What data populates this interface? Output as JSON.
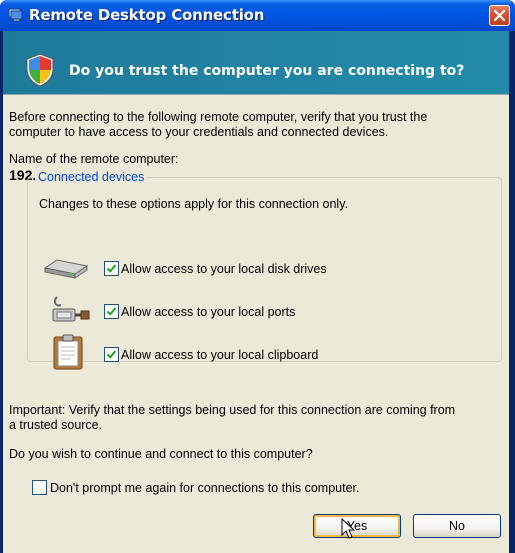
{
  "window": {
    "title": "Remote Desktop Connection"
  },
  "header": {
    "question": "Do you trust the computer you are connecting to?"
  },
  "intro": {
    "line1": "Before connecting to the following remote computer, verify that you trust the",
    "line2": "computer to have access to your credentials and connected devices."
  },
  "remote": {
    "label": "Name of the remote computer:",
    "address": "192.168.3.60"
  },
  "devices": {
    "legend": "Connected devices",
    "note": "Changes to these options apply for this connection only.",
    "items": [
      {
        "label": "Allow access to your local disk drives",
        "checked": true,
        "icon": "disk-drive-icon"
      },
      {
        "label": "Allow access to your local ports",
        "checked": true,
        "icon": "port-plug-icon"
      },
      {
        "label": "Allow access to your local clipboard",
        "checked": true,
        "icon": "clipboard-icon"
      }
    ]
  },
  "important": {
    "line1": "Important: Verify that the settings being used for this connection are coming from",
    "line2": "a trusted source."
  },
  "prompt": "Do you wish to continue and connect to this computer?",
  "dont_prompt": {
    "label": "Don't prompt me again for connections to this computer.",
    "checked": false
  },
  "buttons": {
    "yes": "Yes",
    "no": "No"
  },
  "colors": {
    "title_blue": "#0054e3",
    "header_teal": "#238bab",
    "legend_blue": "#0046d5",
    "close_red": "#d8532c"
  }
}
